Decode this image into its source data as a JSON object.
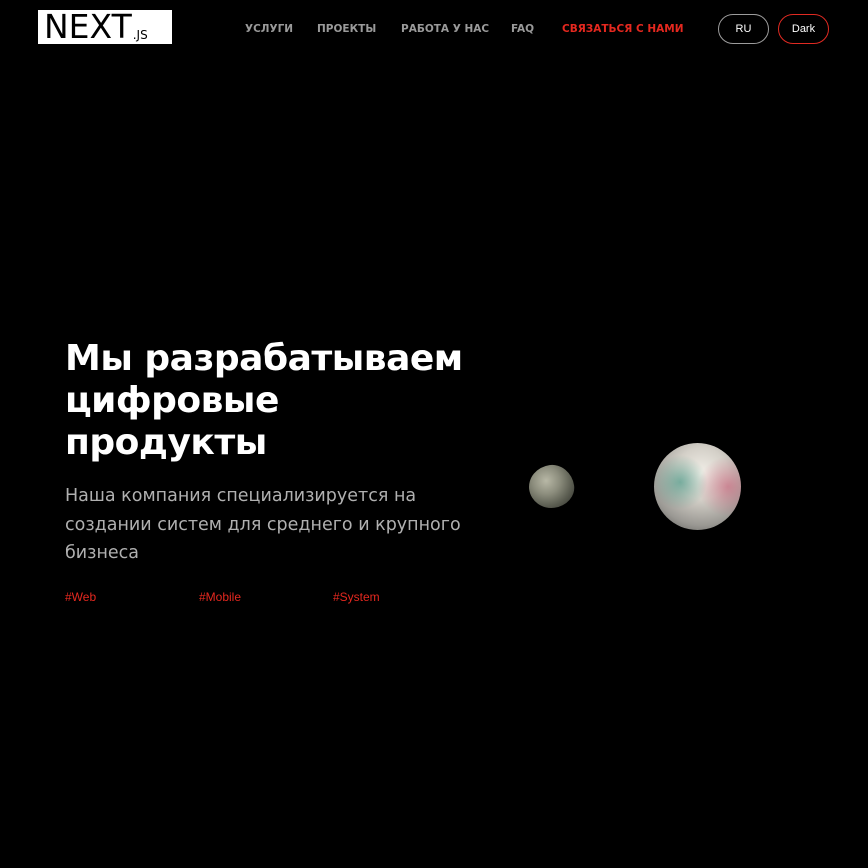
{
  "header": {
    "logo": {
      "main": "NEXT",
      "suffix": ".JS"
    },
    "nav": [
      {
        "label": "УСЛУГИ"
      },
      {
        "label": "ПРОЕКТЫ"
      },
      {
        "label": "РАБОТА У НАС"
      },
      {
        "label": "FAQ"
      },
      {
        "label": "СВЯЗАТЬСЯ С НАМИ"
      }
    ],
    "language_button": "RU",
    "theme_button": "Dark"
  },
  "hero": {
    "title_lines": [
      "Мы разрабатываем",
      "цифровые",
      "продукты"
    ],
    "subtitle": "Наша компания специализируется на создании систем для среднего и крупного бизнеса",
    "tags": [
      "#Web",
      "#Mobile",
      "#System"
    ]
  },
  "colors": {
    "background": "#000000",
    "accent": "#e5281f",
    "nav_text": "#9a9a9a",
    "subtitle_text": "#b0b0b0"
  }
}
